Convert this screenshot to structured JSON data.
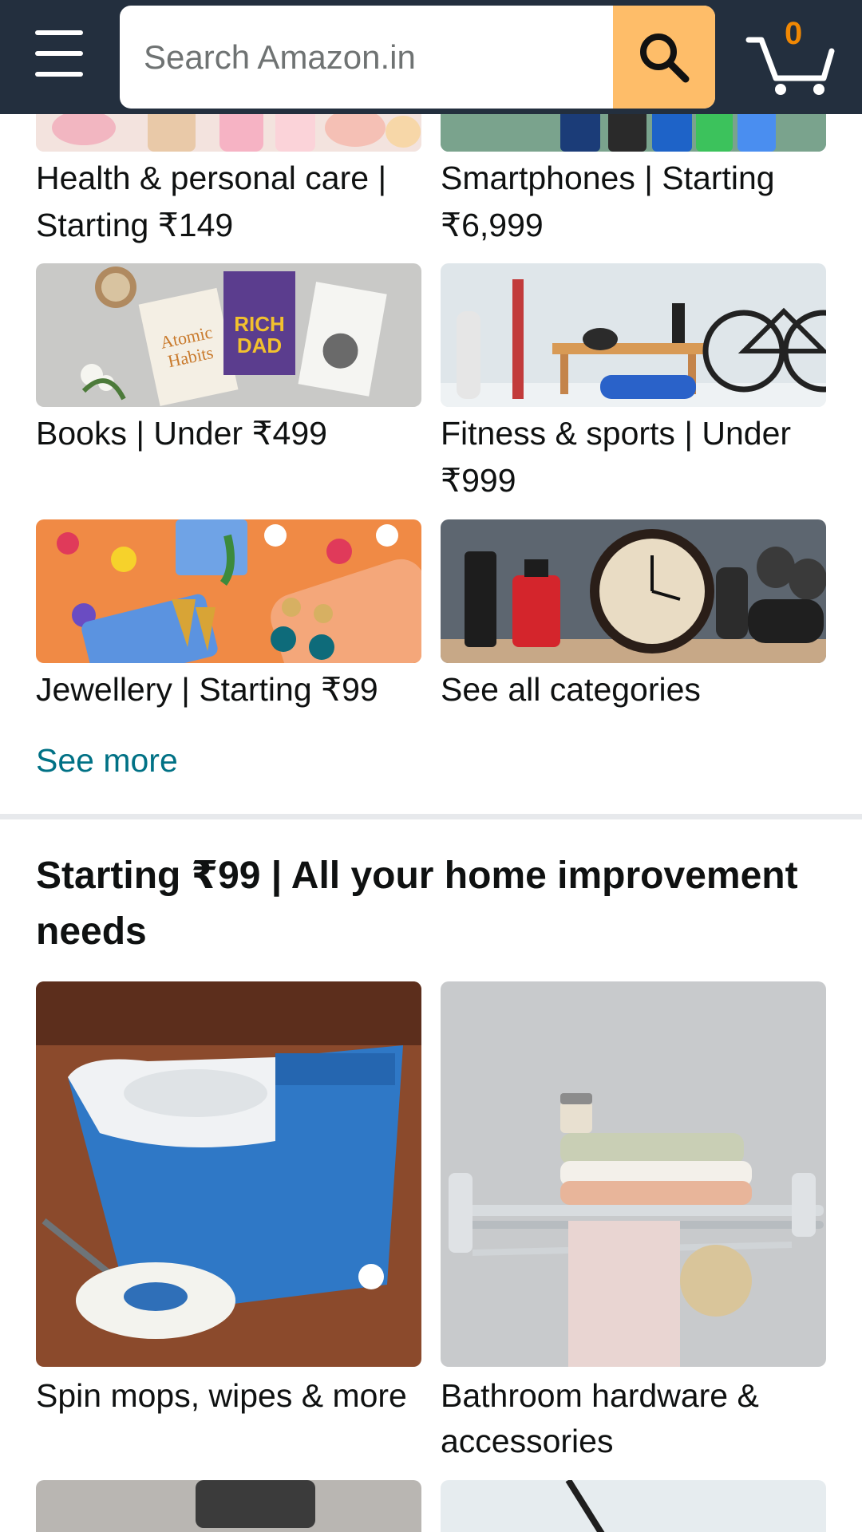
{
  "header": {
    "search_placeholder": "Search Amazon.in",
    "cart_count": "0"
  },
  "categories": [
    {
      "label": "Health & personal care | Starting ₹149"
    },
    {
      "label": "Smartphones | Starting ₹6,999"
    },
    {
      "label": "Books | Under ₹499"
    },
    {
      "label": "Fitness & sports | Under ₹999"
    },
    {
      "label": "Jewellery | Starting ₹99"
    },
    {
      "label": "See all categories"
    }
  ],
  "see_more": "See more",
  "home_section": {
    "title": "Starting ₹99 | All your home improvement needs",
    "items": [
      {
        "label": "Spin mops, wipes & more"
      },
      {
        "label": "Bathroom hardware & accessories"
      }
    ]
  },
  "colors": {
    "header_bg": "#232f3e",
    "search_button": "#febd69",
    "cart_count": "#f08804",
    "link": "#007185"
  }
}
